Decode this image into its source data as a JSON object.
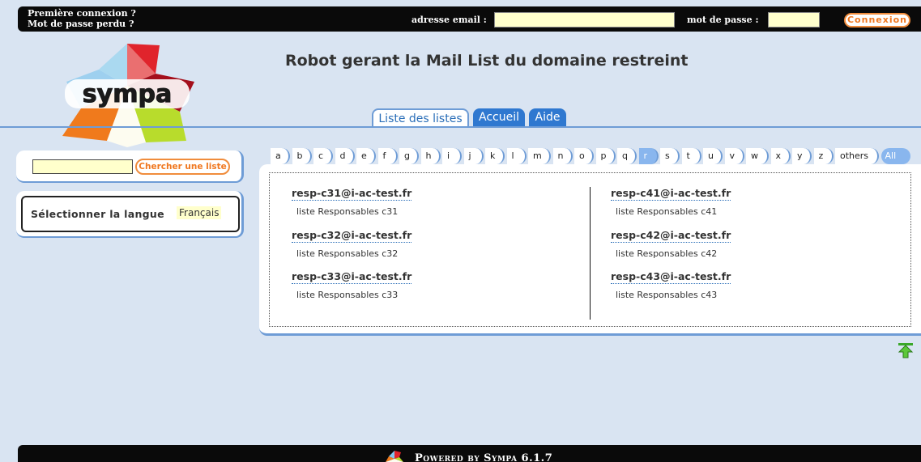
{
  "topbar": {
    "first_login": "Première connexion ?",
    "lost_password": "Mot de passe perdu ?",
    "email_label": "adresse email :",
    "email_value": "",
    "password_label": "mot de passe :",
    "password_value": "",
    "login_button": "Connexion"
  },
  "logo_text": "sympa",
  "page_title": "Robot gerant la Mail List du domaine restreint",
  "tabs": [
    {
      "label": "Liste des listes",
      "active": true
    },
    {
      "label": "Accueil",
      "active": false
    },
    {
      "label": "Aide",
      "active": false
    }
  ],
  "search": {
    "value": "",
    "button": "Chercher une liste"
  },
  "language": {
    "label": "Sélectionner la langue",
    "selected": "Français"
  },
  "alphabet": [
    "a",
    "b",
    "c",
    "d",
    "e",
    "f",
    "g",
    "h",
    "i",
    "j",
    "k",
    "l",
    "m",
    "n",
    "o",
    "p",
    "q",
    "r",
    "s",
    "t",
    "u",
    "v",
    "w",
    "x",
    "y",
    "z",
    "others",
    "All"
  ],
  "alphabet_selected": "r",
  "lists_left": [
    {
      "address": "resp-c31@i-ac-test.fr",
      "description": "liste Responsables c31"
    },
    {
      "address": "resp-c32@i-ac-test.fr",
      "description": "liste Responsables c32"
    },
    {
      "address": "resp-c33@i-ac-test.fr",
      "description": "liste Responsables c33"
    }
  ],
  "lists_right": [
    {
      "address": "resp-c41@i-ac-test.fr",
      "description": "liste Responsables c41"
    },
    {
      "address": "resp-c42@i-ac-test.fr",
      "description": "liste Responsables c42"
    },
    {
      "address": "resp-c43@i-ac-test.fr",
      "description": "liste Responsables c43"
    }
  ],
  "footer": {
    "text": "Powered by Sympa 6.1.7"
  },
  "icons": {
    "top_arrow": "arrow-up-icon",
    "logo": "sympa-logo"
  },
  "colors": {
    "accent_blue": "#2f78d0",
    "accent_orange": "#f08c3c",
    "input_yellow": "#ffffcc",
    "background": "#d9e4f2"
  }
}
